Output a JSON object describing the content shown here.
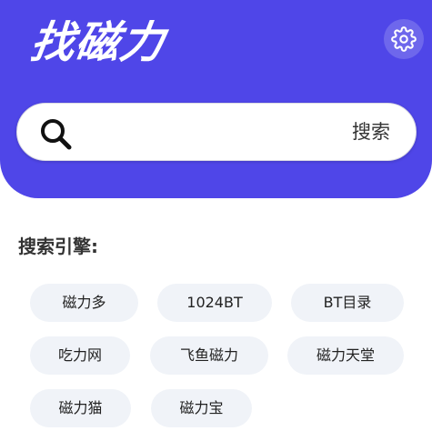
{
  "app": {
    "title": "找磁力"
  },
  "search": {
    "placeholder": "",
    "button_label": "搜索"
  },
  "engines": {
    "heading": "搜索引擎:",
    "items": [
      {
        "label": "磁力多"
      },
      {
        "label": "1024BT"
      },
      {
        "label": "BT目录"
      },
      {
        "label": "吃力网"
      },
      {
        "label": "飞鱼磁力"
      },
      {
        "label": "磁力天堂"
      },
      {
        "label": "磁力猫"
      },
      {
        "label": "磁力宝"
      }
    ]
  },
  "colors": {
    "accent": "#4f46e8",
    "chip_bg": "#f0f3f8"
  },
  "icons": {
    "settings": "gear-icon",
    "search": "search-icon"
  }
}
